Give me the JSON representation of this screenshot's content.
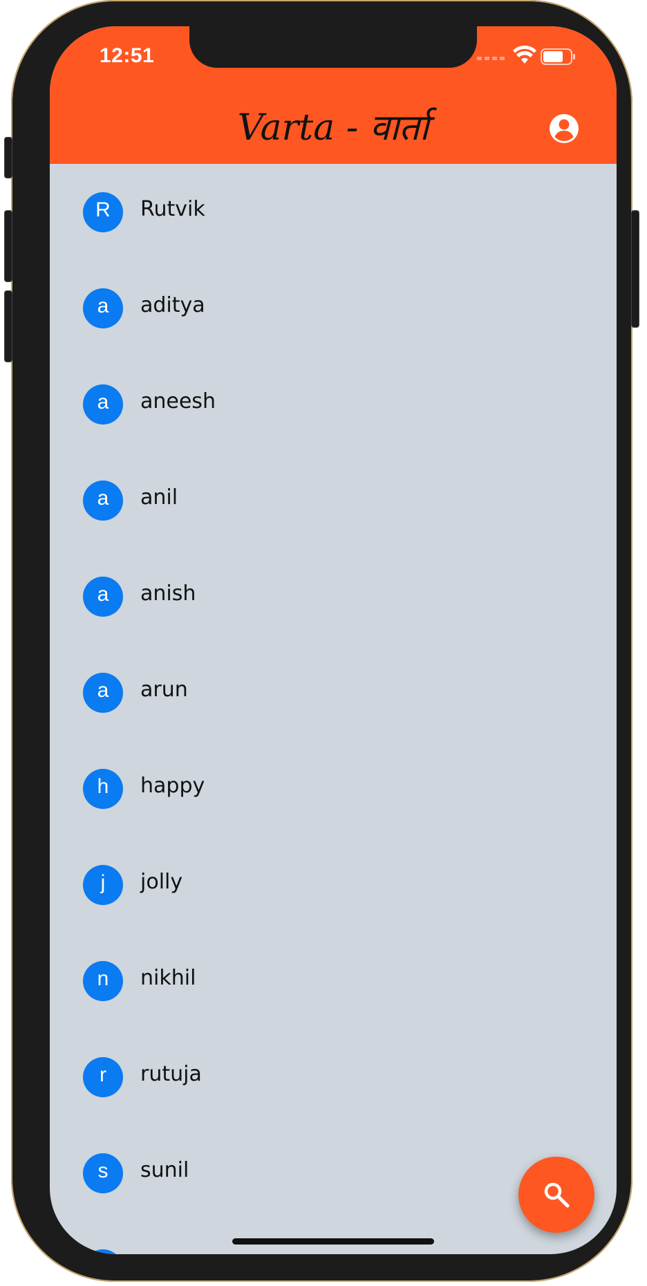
{
  "status_bar": {
    "time": "12:51"
  },
  "app_bar": {
    "title": "Varta - वार्ता",
    "profile_icon": "account-circle-icon"
  },
  "contacts": [
    {
      "initial": "R",
      "name": "Rutvik"
    },
    {
      "initial": "a",
      "name": "aditya"
    },
    {
      "initial": "a",
      "name": "aneesh"
    },
    {
      "initial": "a",
      "name": "anil"
    },
    {
      "initial": "a",
      "name": "anish"
    },
    {
      "initial": "a",
      "name": "arun"
    },
    {
      "initial": "h",
      "name": "happy"
    },
    {
      "initial": "j",
      "name": "jolly"
    },
    {
      "initial": "n",
      "name": "nikhil"
    },
    {
      "initial": "r",
      "name": "rutuja"
    },
    {
      "initial": "s",
      "name": "sunil"
    }
  ],
  "fab": {
    "icon": "search-icon"
  },
  "colors": {
    "accent": "#ff5722",
    "avatar": "#0a7bf1",
    "background": "#cfd6dd"
  }
}
